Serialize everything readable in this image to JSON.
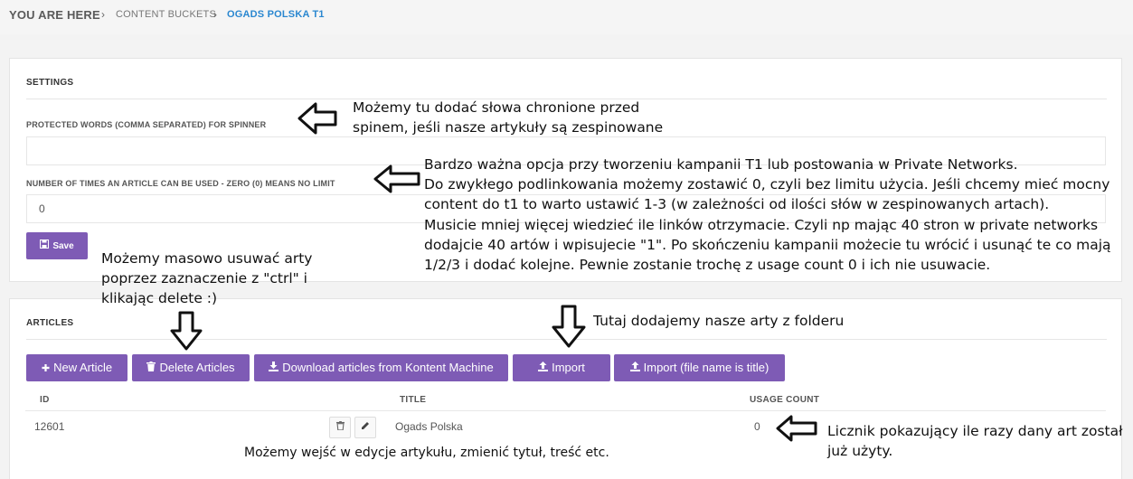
{
  "breadcrumb": {
    "here": "YOU ARE HERE",
    "sep": "›",
    "parent": "CONTENT BUCKETS",
    "current": "OGADS POLSKA T1"
  },
  "settings": {
    "title": "SETTINGS",
    "protected_label": "PROTECTED WORDS (COMMA SEPARATED) FOR SPINNER",
    "protected_value": "",
    "usage_label": "NUMBER OF TIMES AN ARTICLE CAN BE USED - ZERO (0) MEANS NO LIMIT",
    "usage_value": "0",
    "save_label": "Save"
  },
  "articles": {
    "title": "ARTICLES",
    "buttons": {
      "new": "New Article",
      "delete": "Delete Articles",
      "download": "Download articles from Kontent Machine",
      "import": "Import",
      "import_title": "Import (file name is title)"
    },
    "columns": {
      "id": "ID",
      "title": "TITLE",
      "usage": "USAGE COUNT"
    },
    "rows": [
      {
        "id": "12601",
        "title": "Ogads Polska",
        "usage": "0"
      }
    ]
  },
  "annotations": {
    "protected_1": "Możemy tu dodać słowa chronione przed",
    "protected_2": "spinem, jeśli nasze artykuły są zespinowane",
    "usage_1": "Bardzo ważna opcja przy tworzeniu kampanii T1 lub postowania w Private Networks.",
    "usage_2": "Do zwykłego podlinkowania możemy zostawić 0, czyli bez limitu użycia. Jeśli chcemy mieć mocny",
    "usage_3": "content do t1 to warto ustawić 1-3 (w zależności od ilości słów w zespinowanych artach).",
    "usage_4": "Musicie mniej więcej wiedzieć ile linków otrzymacie. Czyli np mając 40 stron w private networks",
    "usage_5": "dodajcie 40 artów i wpisujecie \"1\".  Po skończeniu kampanii możecie tu wrócić i usunąć te co mają",
    "usage_6": "1/2/3 i dodać kolejne. Pewnie zostanie trochę z usage count 0 i ich nie usuwacie.",
    "delete_1": "Możemy masowo usuwać arty",
    "delete_2": "poprzez zaznaczenie z \"ctrl\" i",
    "delete_3": "klikając delete :)",
    "import": "Tutaj dodajemy nasze arty z folderu",
    "edit": "Możemy wejść w edycje artykułu, zmienić tytuł, treść etc.",
    "counter_1": "Licznik pokazujący ile razy dany art został",
    "counter_2": "już użyty."
  },
  "colors": {
    "button": "#7e5bb5",
    "link": "#2a87d0"
  }
}
